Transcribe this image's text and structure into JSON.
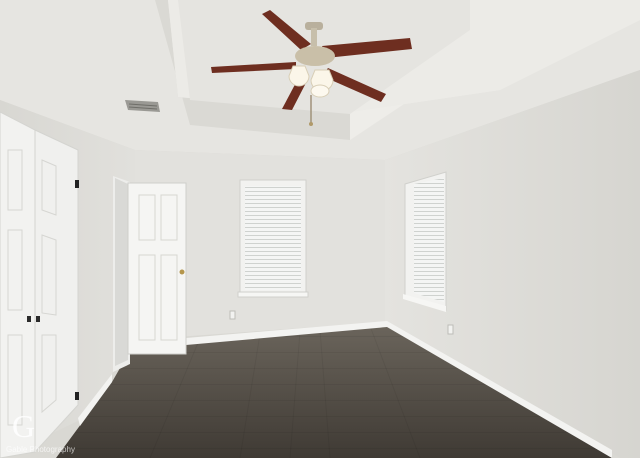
{
  "photo": {
    "subject": "Empty bedroom",
    "watermark": {
      "logo_letter": "G",
      "caption": "Gable Photography"
    },
    "colors": {
      "wall": "#e3e2de",
      "ceiling": "#e7e6e2",
      "floor": "#4e4942",
      "trim": "#f4f4f2",
      "fan_blade": "#6e2e20"
    }
  }
}
